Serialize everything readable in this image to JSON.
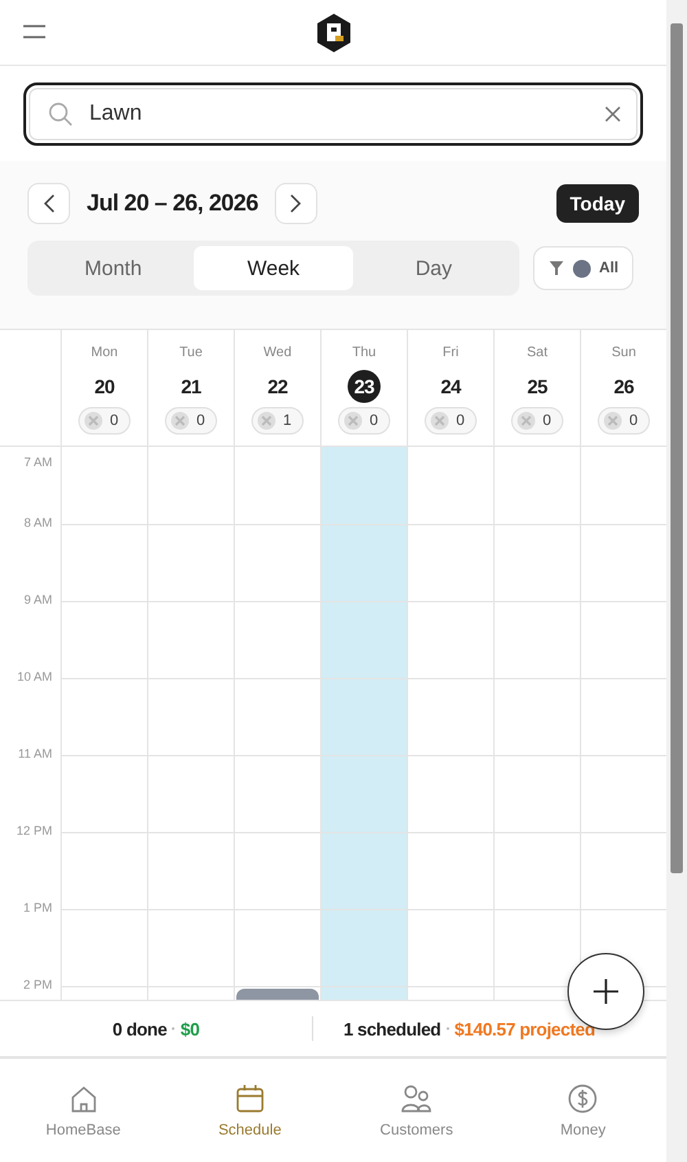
{
  "search": {
    "value": "Lawn"
  },
  "week_nav": {
    "range": "Jul 20 – 26, 2026",
    "today_button": "Today"
  },
  "views": [
    {
      "label": "Month",
      "selected": false
    },
    {
      "label": "Week",
      "selected": true
    },
    {
      "label": "Day",
      "selected": false
    }
  ],
  "filter": {
    "label": "All",
    "color": "#6b7385"
  },
  "days": [
    {
      "weekday": "Mon",
      "date": "20",
      "today": false,
      "count": "0"
    },
    {
      "weekday": "Tue",
      "date": "21",
      "today": false,
      "count": "0"
    },
    {
      "weekday": "Wed",
      "date": "22",
      "today": false,
      "count": "1",
      "events": [
        {
          "color": "#8e96a3"
        }
      ]
    },
    {
      "weekday": "Thu",
      "date": "23",
      "today": true,
      "count": "0"
    },
    {
      "weekday": "Fri",
      "date": "24",
      "today": false,
      "count": "0"
    },
    {
      "weekday": "Sat",
      "date": "25",
      "today": false,
      "count": "0"
    },
    {
      "weekday": "Sun",
      "date": "26",
      "today": false,
      "count": "0"
    }
  ],
  "hours": [
    "7 AM",
    "8 AM",
    "9 AM",
    "10 AM",
    "11 AM",
    "12 PM",
    "1 PM",
    "2 PM"
  ],
  "summary": {
    "done": "0 done",
    "done_amount": "$0",
    "scheduled": "1 scheduled",
    "projected": "$140.57 projected"
  },
  "nav": [
    {
      "label": "HomeBase",
      "selected": false
    },
    {
      "label": "Schedule",
      "selected": true
    },
    {
      "label": "Customers",
      "selected": false
    },
    {
      "label": "Money",
      "selected": false
    }
  ]
}
